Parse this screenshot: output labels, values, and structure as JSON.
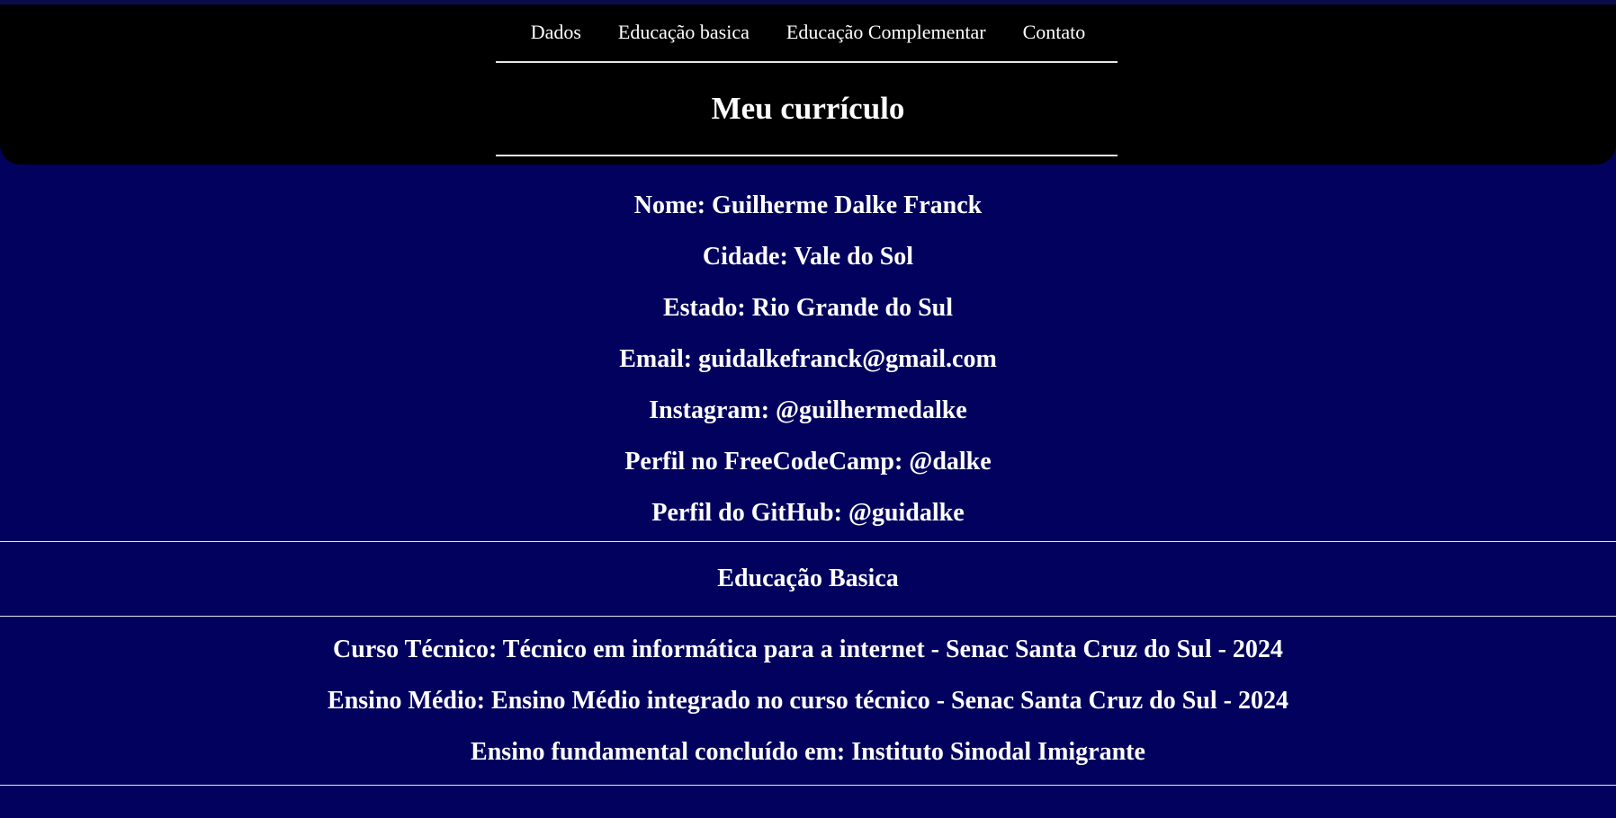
{
  "nav": {
    "items": [
      {
        "label": "Dados"
      },
      {
        "label": "Educação basica"
      },
      {
        "label": "Educação Complementar"
      },
      {
        "label": "Contato"
      }
    ]
  },
  "header": {
    "title": "Meu currículo"
  },
  "dados": {
    "lines": [
      "Nome: Guilherme Dalke Franck",
      "Cidade: Vale do Sol",
      "Estado: Rio Grande do Sul",
      "Email: guidalkefranck@gmail.com",
      "Instagram: @guilhermedalke",
      "Perfil no FreeCodeCamp: @dalke",
      "Perfil do GitHub: @guidalke"
    ]
  },
  "educacao_basica": {
    "title": "Educação Basica",
    "lines": [
      "Curso Técnico: Técnico em informática para a internet - Senac Santa Cruz do Sul - 2024",
      "Ensino Médio: Ensino Médio integrado no curso técnico - Senac Santa Cruz do Sul - 2024",
      "Ensino fundamental concluído em: Instituto Sinodal Imigrante"
    ]
  },
  "colors": {
    "background": "#02025e",
    "header_background": "#000000",
    "text": "#ffffff",
    "rule": "#e6e6e6"
  }
}
